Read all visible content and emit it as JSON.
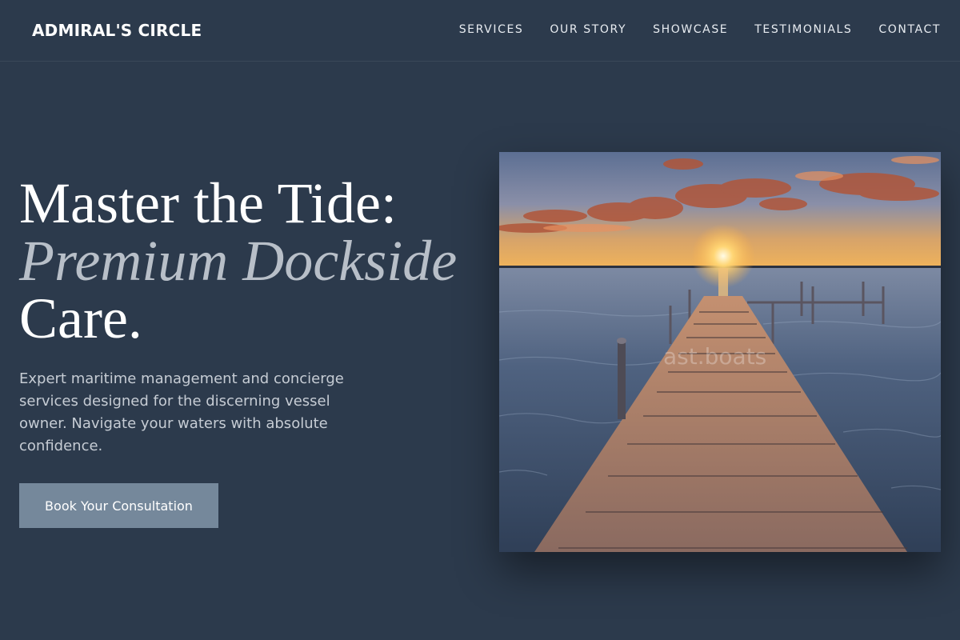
{
  "nav": {
    "logo": "ADMIRAL'S CIRCLE",
    "links": [
      "SERVICES",
      "OUR STORY",
      "SHOWCASE",
      "TESTIMONIALS",
      "CONTACT"
    ]
  },
  "hero": {
    "headline_line1": "Master the Tide:",
    "headline_accent": "Premium Dockside",
    "headline_line3": "Care.",
    "description": "Expert maritime management and concierge services designed for the discerning vessel owner. Navigate your waters with absolute confidence.",
    "cta_label": "Book Your Consultation",
    "image_watermark": "ast.boats"
  },
  "colors": {
    "background": "#2c3a4c",
    "accent_text": "#b8bfc8",
    "cta_background": "#75889b"
  }
}
